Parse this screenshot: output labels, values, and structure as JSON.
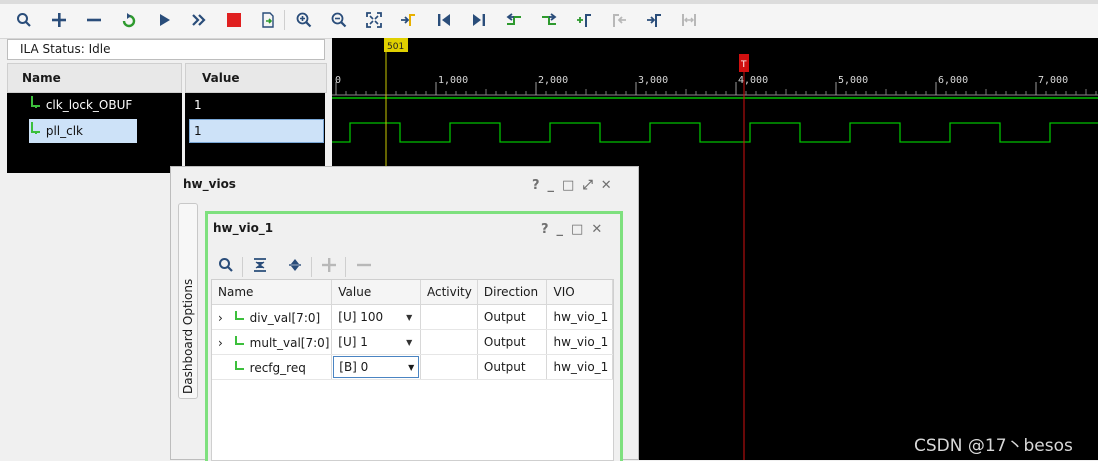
{
  "toolbar": {
    "buttons": [
      "search-icon",
      "add-icon",
      "remove-icon",
      "refresh-icon",
      "run-icon",
      "run-immediate-icon",
      "stop-icon",
      "export-icon",
      "zoom-in-icon",
      "zoom-out-icon",
      "zoom-fit-icon",
      "go-to-cursor-icon",
      "go-to-time-zero-icon",
      "go-to-last-time-icon",
      "previous-transition-icon",
      "next-transition-icon",
      "add-marker-icon",
      "previous-marker-icon",
      "next-marker-icon",
      "swap-cursors-icon"
    ],
    "colors": {
      "stop": "#e02020",
      "green": "#2e9a2e",
      "blue": "#2266bb",
      "disabled": "#b8b8b8"
    }
  },
  "ila": {
    "status_label": "ILA Status:",
    "status_value": "Idle",
    "name_header": "Name",
    "value_header": "Value",
    "signals": [
      {
        "name": "clk_lock_OBUF",
        "value": "1"
      },
      {
        "name": "pll_clk",
        "value": "1"
      }
    ]
  },
  "waveform": {
    "cursor_label": "501",
    "trigger_marker": "T",
    "ruler_labels": [
      "0",
      "1,000",
      "2,000",
      "3,000",
      "4,000",
      "5,000",
      "6,000",
      "7,000"
    ],
    "colors": {
      "background": "#000000",
      "signal": "#00c000",
      "cursor": "#c8c800",
      "trigger": "#d01010"
    }
  },
  "hw_vios": {
    "title": "hw_vios",
    "side_tab": "Dashboard Options",
    "controls": [
      "?",
      "_",
      "□",
      "⤢",
      "✕"
    ],
    "panel": {
      "title": "hw_vio_1",
      "controls": [
        "?",
        "_",
        "□",
        "✕"
      ],
      "columns": [
        "Name",
        "Value",
        "Activity",
        "Direction",
        "VIO"
      ],
      "rows": [
        {
          "expand": "›",
          "name": "div_val[7:0]",
          "value": "[U] 100",
          "activity": "",
          "direction": "Output",
          "vio": "hw_vio_1"
        },
        {
          "expand": "›",
          "name": "mult_val[7:0]",
          "value": "[U] 1",
          "activity": "",
          "direction": "Output",
          "vio": "hw_vio_1"
        },
        {
          "expand": "",
          "name": "recfg_req",
          "value": "[B] 0",
          "activity": "",
          "direction": "Output",
          "vio": "hw_vio_1"
        }
      ]
    }
  },
  "watermark": "CSDN @17丶besos"
}
